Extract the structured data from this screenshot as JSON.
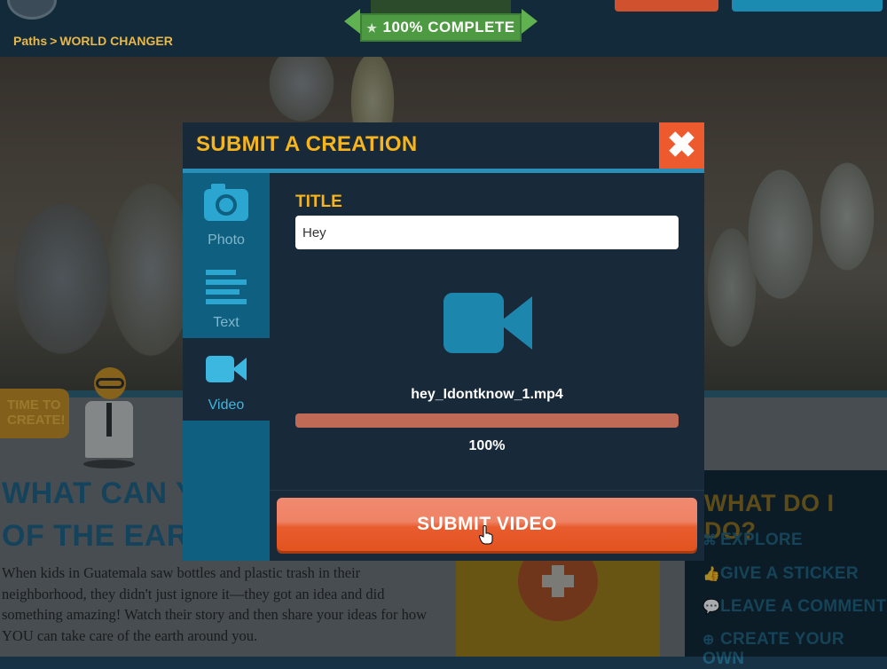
{
  "nav": {
    "badge_text": "100% COMPLETE",
    "badge_star": "★",
    "breadcrumb": {
      "root": "Paths",
      "separator": ">",
      "current": "WORLD CHANGER"
    }
  },
  "page": {
    "time_tag": {
      "line1": "TIME TO",
      "line2": "CREATE!"
    },
    "heading_line1": "WHAT CAN YOU",
    "heading_line2": "OF THE EARTH?",
    "body": "When kids in Guatemala saw bottles and plastic trash in their neighborhood, they didn't just ignore it—they got an idea and did something amazing! Watch their story and then share your ideas for how YOU can take care of the earth around you."
  },
  "what_do_i_do": {
    "title": "WHAT DO I DO?",
    "items": [
      {
        "label": "EXPLORE",
        "icon": "binoculars-icon",
        "glyph": "⌘"
      },
      {
        "label": "GIVE A STICKER",
        "icon": "thumbs-up-icon",
        "glyph": "👍"
      },
      {
        "label": "LEAVE A COMMENT",
        "icon": "comment-icon",
        "glyph": "💬"
      },
      {
        "label": "CREATE YOUR OWN",
        "icon": "plus-circle-icon",
        "glyph": "⊕"
      }
    ]
  },
  "modal": {
    "title": "SUBMIT A CREATION",
    "close_glyph": "✖",
    "tabs": [
      {
        "label": "Photo",
        "icon": "camera-icon",
        "active": false
      },
      {
        "label": "Text",
        "icon": "text-lines-icon",
        "active": false
      },
      {
        "label": "Video",
        "icon": "video-camera-icon",
        "active": true
      }
    ],
    "field_label": "TITLE",
    "title_value": "Hey",
    "file_name": "hey_Idontknow_1.mp4",
    "progress_percent": 100,
    "progress_label": "100%",
    "submit_label": "SUBMIT VIDEO"
  },
  "colors": {
    "accent_yellow": "#f6b51c",
    "accent_blue": "#2a8fb8",
    "close_orange": "#ec5a2e",
    "submit_orange": "#e95c2f",
    "progress_fill": "#bf6a57"
  }
}
